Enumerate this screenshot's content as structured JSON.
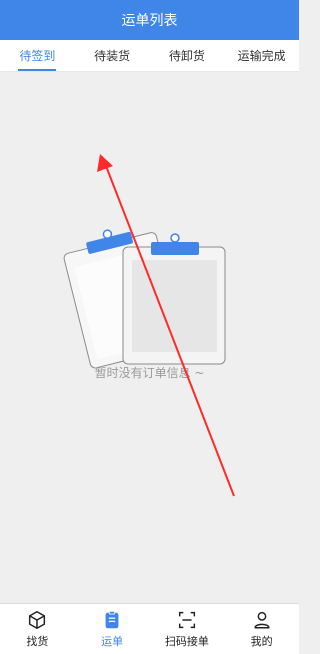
{
  "header": {
    "title": "运单列表"
  },
  "tabs": [
    {
      "label": "待签到",
      "active": true
    },
    {
      "label": "待装货",
      "active": false
    },
    {
      "label": "待卸货",
      "active": false
    },
    {
      "label": "运输完成",
      "active": false
    }
  ],
  "empty_state": {
    "message": "暂时没有订单信息 ~"
  },
  "bottom_nav": [
    {
      "label": "找货",
      "icon": "box-icon",
      "active": false
    },
    {
      "label": "运单",
      "icon": "clipboard-icon",
      "active": true
    },
    {
      "label": "扫码接单",
      "icon": "scan-icon",
      "active": false
    },
    {
      "label": "我的",
      "icon": "user-icon",
      "active": false
    }
  ],
  "colors": {
    "accent": "#3f86e8",
    "annotation_arrow": "#ff2a2a",
    "background": "#efefef"
  }
}
